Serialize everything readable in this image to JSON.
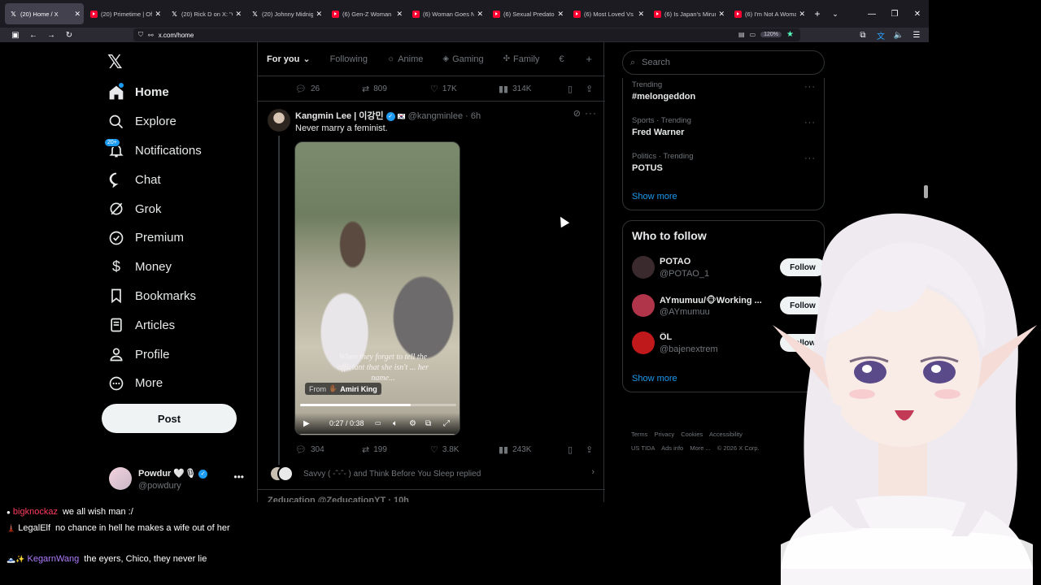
{
  "browser": {
    "tabs": [
      {
        "label": "(20) Home / X",
        "icon": "x",
        "active": true
      },
      {
        "label": "(20) Primetime | Offici",
        "icon": "youtube",
        "active": false
      },
      {
        "label": "(20) Rick D on X: \"O",
        "icon": "x",
        "active": false
      },
      {
        "label": "(20) Johnny Midnight",
        "icon": "x",
        "active": false
      },
      {
        "label": "(6) Gen-Z Woman S",
        "icon": "youtube",
        "active": false
      },
      {
        "label": "(6) Woman Goes N",
        "icon": "youtube",
        "active": false
      },
      {
        "label": "(6) Sexual Predator",
        "icon": "youtube",
        "active": false
      },
      {
        "label": "(6) Most Loved Vs M",
        "icon": "youtube",
        "active": false
      },
      {
        "label": "(6) Is Japan's Mirum",
        "icon": "youtube",
        "active": false
      },
      {
        "label": "(6) I'm Not A Woma",
        "icon": "youtube",
        "active": false
      }
    ],
    "url": "x.com/home",
    "zoom": "120%"
  },
  "sidebar": {
    "items": [
      {
        "label": "Home",
        "icon": "home-icon"
      },
      {
        "label": "Explore",
        "icon": "search-icon"
      },
      {
        "label": "Notifications",
        "icon": "bell-icon",
        "badge": "20+"
      },
      {
        "label": "Chat",
        "icon": "chat-icon"
      },
      {
        "label": "Grok",
        "icon": "grok-icon"
      },
      {
        "label": "Premium",
        "icon": "premium-icon"
      },
      {
        "label": "Money",
        "icon": "money-icon"
      },
      {
        "label": "Bookmarks",
        "icon": "bookmark-icon"
      },
      {
        "label": "Articles",
        "icon": "articles-icon"
      },
      {
        "label": "Profile",
        "icon": "profile-icon"
      },
      {
        "label": "More",
        "icon": "more-icon"
      }
    ],
    "post_label": "Post",
    "account": {
      "name": "Powdur",
      "handle": "@powdury"
    }
  },
  "feed": {
    "tabs": [
      {
        "label": "For you",
        "active": true,
        "icon": ""
      },
      {
        "label": "Following",
        "active": false,
        "icon": ""
      },
      {
        "label": "Anime",
        "active": false,
        "icon": "☼"
      },
      {
        "label": "Gaming",
        "active": false,
        "icon": "◈"
      },
      {
        "label": "Family",
        "active": false,
        "icon": "✣"
      }
    ],
    "prev_actions": {
      "replies": "26",
      "reposts": "809",
      "likes": "17K",
      "views": "314K"
    },
    "tweet": {
      "author": "Kangmin Lee | 이강민",
      "handle": "@kangminlee",
      "time": "6h",
      "text": "Never marry a feminist.",
      "video_caption": "When they forget to tell the officiant that she isn't ... her name...",
      "from_label": "From",
      "from_name": "Amiri King",
      "video_time": "0:27 / 0:38",
      "video_progress": 0.71,
      "actions": {
        "replies": "304",
        "reposts": "199",
        "likes": "3.8K",
        "views": "243K"
      },
      "replied_text": "Savvy ( -ˆ-ˆ- ) and Think Before You Sleep replied"
    },
    "next_tweet_preview": "Zeducation  @ZeducationYT · 10h"
  },
  "right": {
    "search_placeholder": "Search",
    "trends": [
      {
        "meta": "Trending",
        "name": "#melongeddon"
      },
      {
        "meta": "Sports · Trending",
        "name": "Fred Warner"
      },
      {
        "meta": "Politics · Trending",
        "name": "POTUS"
      }
    ],
    "show_more": "Show more",
    "who_to_follow": {
      "title": "Who to follow",
      "users": [
        {
          "name": "POTAO",
          "handle": "@POTAO_1",
          "color": "#3a2a2e",
          "button": "Follow"
        },
        {
          "name": "AYmumuu/🐵Working ...",
          "handle": "@AYmumuu",
          "color": "#b0344a",
          "button": "Follow"
        },
        {
          "name": "ÖL",
          "handle": "@bajenextrem",
          "color": "#c0191c",
          "button": "Follow"
        }
      ],
      "show_more": "Show more"
    },
    "footer": [
      "Terms",
      "Privacy",
      "Cookies",
      "Accessibility",
      "US TIDA",
      "Ads info",
      "More ...",
      "© 2026 X Corp."
    ]
  },
  "chat": [
    {
      "badge": "●",
      "name": "bigknockaz",
      "name_color": "#ff3b5c",
      "text": "we all wish man :/"
    },
    {
      "badge": "🗼",
      "name": "LegalElf",
      "name_color": "#ffffff",
      "text": "no chance in hell he makes a wife out of her"
    },
    {
      "badge": "🗻✨",
      "name": "KegarnWang",
      "name_color": "#b07cff",
      "text": "the eyers, Chico, they never lie"
    }
  ]
}
